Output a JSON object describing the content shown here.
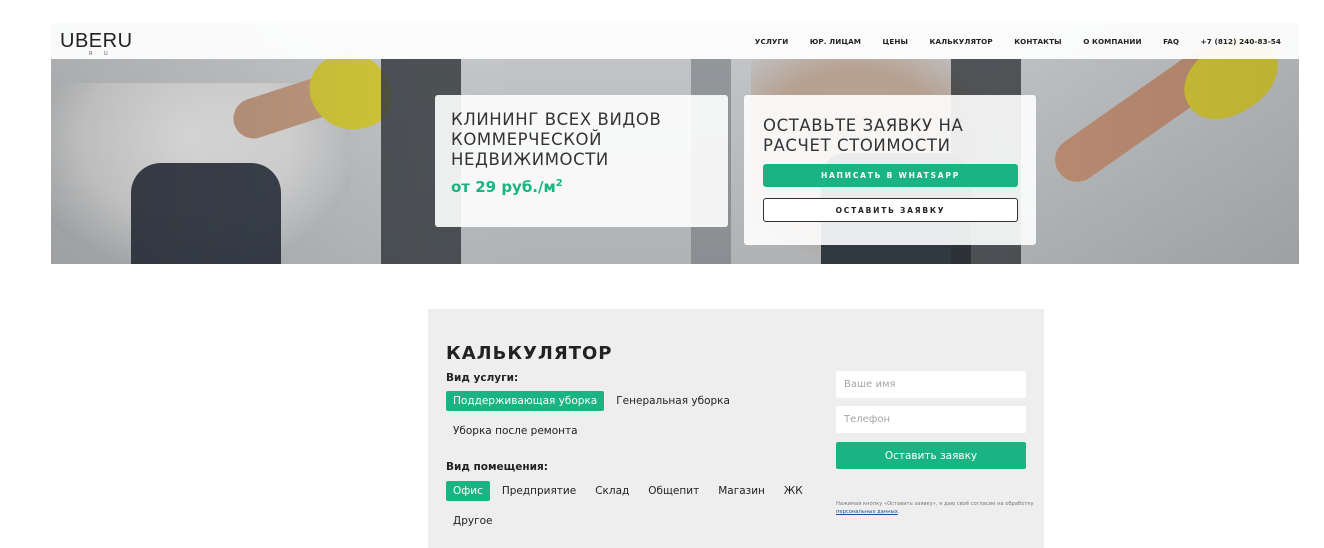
{
  "brand": {
    "logo": "UBERU",
    "logo_sub": "R U"
  },
  "nav": [
    {
      "label": "УСЛУГИ",
      "name": "nav-services"
    },
    {
      "label": "ЮР. ЛИЦАМ",
      "name": "nav-legal"
    },
    {
      "label": "ЦЕНЫ",
      "name": "nav-prices"
    },
    {
      "label": "КАЛЬКУЛЯТОР",
      "name": "nav-calculator"
    },
    {
      "label": "КОНТАКТЫ",
      "name": "nav-contacts"
    },
    {
      "label": "О КОМПАНИИ",
      "name": "nav-about"
    },
    {
      "label": "FAQ",
      "name": "nav-faq"
    },
    {
      "label": "+7 (812) 240-83-54",
      "name": "nav-phone"
    }
  ],
  "hero": {
    "title_lines": [
      "КЛИНИНГ ВСЕХ ВИДОВ",
      "КОММЕРЧЕСКОЙ",
      "НЕДВИЖИМОСТИ"
    ],
    "price_text": "от 29 руб./м",
    "price_sup": "2"
  },
  "request_form": {
    "title_lines": [
      "ОСТАВЬТЕ ЗАЯВКУ НА",
      "РАСЧЕТ СТОИМОСТИ"
    ],
    "whatsapp_label": "НАПИСАТЬ В WHATSAPP",
    "order_label": "ОСТАВИТЬ ЗАЯВКУ"
  },
  "calculator": {
    "title": "КАЛЬКУЛЯТОР",
    "service_label": "Вид услуги:",
    "services": [
      {
        "label": "Поддерживающая уборка",
        "active": true
      },
      {
        "label": "Генеральная уборка",
        "active": false
      },
      {
        "label": "Уборка после ремонта",
        "active": false
      }
    ],
    "premises_label": "Вид помещения:",
    "premises": [
      {
        "label": "Офис",
        "active": true
      },
      {
        "label": "Предприятие",
        "active": false
      },
      {
        "label": "Склад",
        "active": false
      },
      {
        "label": "Общепит",
        "active": false
      },
      {
        "label": "Магазин",
        "active": false
      },
      {
        "label": "ЖК",
        "active": false
      },
      {
        "label": "Другое",
        "active": false
      }
    ],
    "name_placeholder": "Ваше имя",
    "phone_placeholder": "Телефон",
    "submit_label": "Оставить заявку",
    "consent_text": "Нажимая кнопку «Оставить заявку», я даю своё согласие на обработку ",
    "consent_link": "персональных данных",
    "consent_end": "."
  },
  "colors": {
    "accent": "#19b482",
    "panel": "#eeeeee",
    "link": "#1c4f86"
  }
}
